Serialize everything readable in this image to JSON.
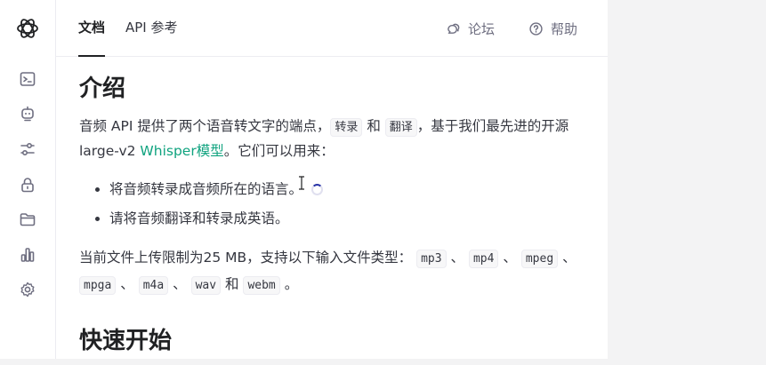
{
  "header": {
    "tabs": [
      {
        "label": "文档"
      },
      {
        "label": "API 参考"
      }
    ],
    "forum_label": "论坛",
    "help_label": "帮助"
  },
  "sidebar": {
    "icons": [
      "terminal-icon",
      "robot-icon",
      "sliders-icon",
      "lock-icon",
      "folder-icon",
      "bar-chart-icon",
      "gear-icon"
    ]
  },
  "content": {
    "intro_title": "介绍",
    "intro_p1_a": "音频 API 提供了两个语音转文字的端点，",
    "intro_code_transcribe": "转录",
    "intro_p1_and": " 和 ",
    "intro_code_translate": "翻译",
    "intro_p1_b": "，基于我们最先进的开源 large-v2 ",
    "intro_link": "Whisper模型",
    "intro_p1_c": "。它们可以用来：",
    "bullets": [
      "将音频转录成音频所在的语言。",
      "请将音频翻译和转录成英语。"
    ],
    "limit_p_a": "当前文件上传限制为25 MB，支持以下输入文件类型：",
    "file_types": [
      "mp3",
      "mp4",
      "mpeg",
      "mpga",
      "m4a",
      "wav",
      "webm"
    ],
    "sep": "、",
    "and_word": "和",
    "period": "。",
    "quickstart_title": "快速开始"
  },
  "colors": {
    "accent": "#10a37f",
    "text": "#353740",
    "heading": "#202123",
    "border": "#ececf1"
  }
}
